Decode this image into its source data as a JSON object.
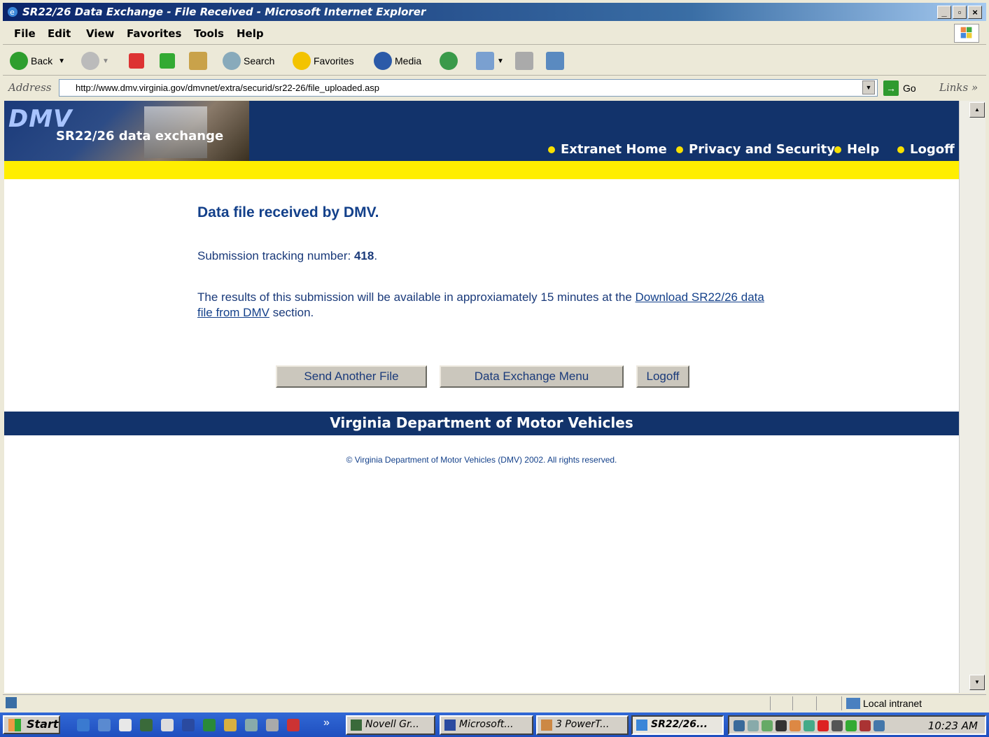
{
  "window": {
    "title": "SR22/26 Data Exchange - File Received - Microsoft Internet Explorer"
  },
  "menu": [
    "File",
    "Edit",
    "View",
    "Favorites",
    "Tools",
    "Help"
  ],
  "toolbar": {
    "back": "Back",
    "search": "Search",
    "favorites": "Favorites",
    "media": "Media"
  },
  "address": {
    "label": "Address",
    "url": "http://www.dmv.virginia.gov/dmvnet/extra/securid/sr22-26/file_uploaded.asp",
    "go": "Go",
    "links": "Links"
  },
  "banner": {
    "logo": "DMV",
    "subtitle": "SR22/26 data exchange",
    "nav": [
      "Extranet Home",
      "Privacy and Security",
      "Help",
      "Logoff"
    ]
  },
  "content": {
    "heading": "Data file received by DMV.",
    "tracking_label": "Submission tracking number: ",
    "tracking_number": "418",
    "tracking_suffix": ".",
    "results_prefix": "The results of this submission will be available in approxiamately 15 minutes at the ",
    "results_link": "Download SR22/26 data file from DMV",
    "results_suffix": " section."
  },
  "buttons": {
    "send": "Send Another File",
    "menu": "Data Exchange Menu",
    "logoff": "Logoff"
  },
  "footer": {
    "bar": "Virginia Department of Motor Vehicles",
    "copyright": "© Virginia Department of Motor Vehicles (DMV) 2002. All rights reserved."
  },
  "status": {
    "zone": "Local intranet"
  },
  "taskbar": {
    "start": "Start",
    "tasks": [
      "Novell Gr...",
      "Microsoft...",
      "3 PowerT...",
      "SR22/26..."
    ],
    "clock": "10:23 AM"
  }
}
